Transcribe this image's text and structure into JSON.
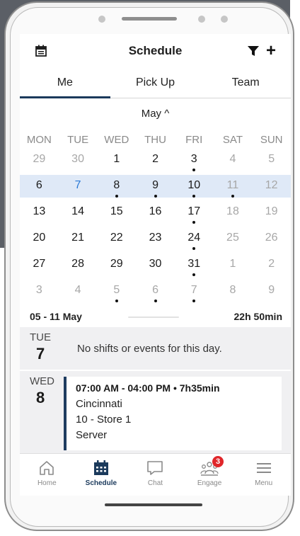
{
  "header": {
    "title": "Schedule"
  },
  "tabs": [
    {
      "label": "Me"
    },
    {
      "label": "Pick Up"
    },
    {
      "label": "Team"
    }
  ],
  "calendar": {
    "month_label": "May ^",
    "weekdays": [
      "MON",
      "TUE",
      "WED",
      "THU",
      "FRI",
      "SAT",
      "SUN"
    ],
    "weeks": [
      [
        {
          "d": "29",
          "muted": true
        },
        {
          "d": "30",
          "muted": true
        },
        {
          "d": "1"
        },
        {
          "d": "2"
        },
        {
          "d": "3",
          "dot": true
        },
        {
          "d": "4",
          "muted": true
        },
        {
          "d": "5",
          "muted": true
        }
      ],
      [
        {
          "d": "6"
        },
        {
          "d": "7",
          "today": true
        },
        {
          "d": "8",
          "dot": true
        },
        {
          "d": "9",
          "dot": true
        },
        {
          "d": "10",
          "dot": true
        },
        {
          "d": "11",
          "muted": true,
          "dot": true
        },
        {
          "d": "12",
          "muted": true
        }
      ],
      [
        {
          "d": "13"
        },
        {
          "d": "14"
        },
        {
          "d": "15"
        },
        {
          "d": "16"
        },
        {
          "d": "17",
          "dot": true
        },
        {
          "d": "18",
          "muted": true
        },
        {
          "d": "19",
          "muted": true
        }
      ],
      [
        {
          "d": "20"
        },
        {
          "d": "21"
        },
        {
          "d": "22"
        },
        {
          "d": "23"
        },
        {
          "d": "24",
          "dot": true
        },
        {
          "d": "25",
          "muted": true
        },
        {
          "d": "26",
          "muted": true
        }
      ],
      [
        {
          "d": "27"
        },
        {
          "d": "28"
        },
        {
          "d": "29"
        },
        {
          "d": "30"
        },
        {
          "d": "31",
          "dot": true
        },
        {
          "d": "1",
          "muted": true
        },
        {
          "d": "2",
          "muted": true
        }
      ],
      [
        {
          "d": "3",
          "muted": true
        },
        {
          "d": "4",
          "muted": true
        },
        {
          "d": "5",
          "muted": true,
          "dot": true
        },
        {
          "d": "6",
          "muted": true,
          "dot": true
        },
        {
          "d": "7",
          "muted": true,
          "dot": true
        },
        {
          "d": "8",
          "muted": true
        },
        {
          "d": "9",
          "muted": true
        }
      ]
    ],
    "selected_week_index": 1
  },
  "summary": {
    "range": "05 - 11 May",
    "total_hours": "22h 50min"
  },
  "days": [
    {
      "dow": "TUE",
      "day": "7",
      "empty_text": "No shifts or events for this day."
    },
    {
      "dow": "WED",
      "day": "8",
      "event": {
        "time": "07:00 AM - 04:00 PM • 7h35min",
        "location": "Cincinnati",
        "store": "10 - Store 1",
        "role": "Server"
      }
    }
  ],
  "nav": {
    "items": [
      {
        "label": "Home",
        "icon": "home-icon"
      },
      {
        "label": "Schedule",
        "icon": "calendar-icon"
      },
      {
        "label": "Chat",
        "icon": "chat-icon"
      },
      {
        "label": "Engage",
        "icon": "engage-icon",
        "badge": "3"
      },
      {
        "label": "Menu",
        "icon": "menu-icon"
      }
    ]
  },
  "colors": {
    "accent": "#1b3a5c",
    "today": "#2a79d6",
    "selected_week_bg": "#dfe9f7",
    "badge": "#e0262a"
  }
}
